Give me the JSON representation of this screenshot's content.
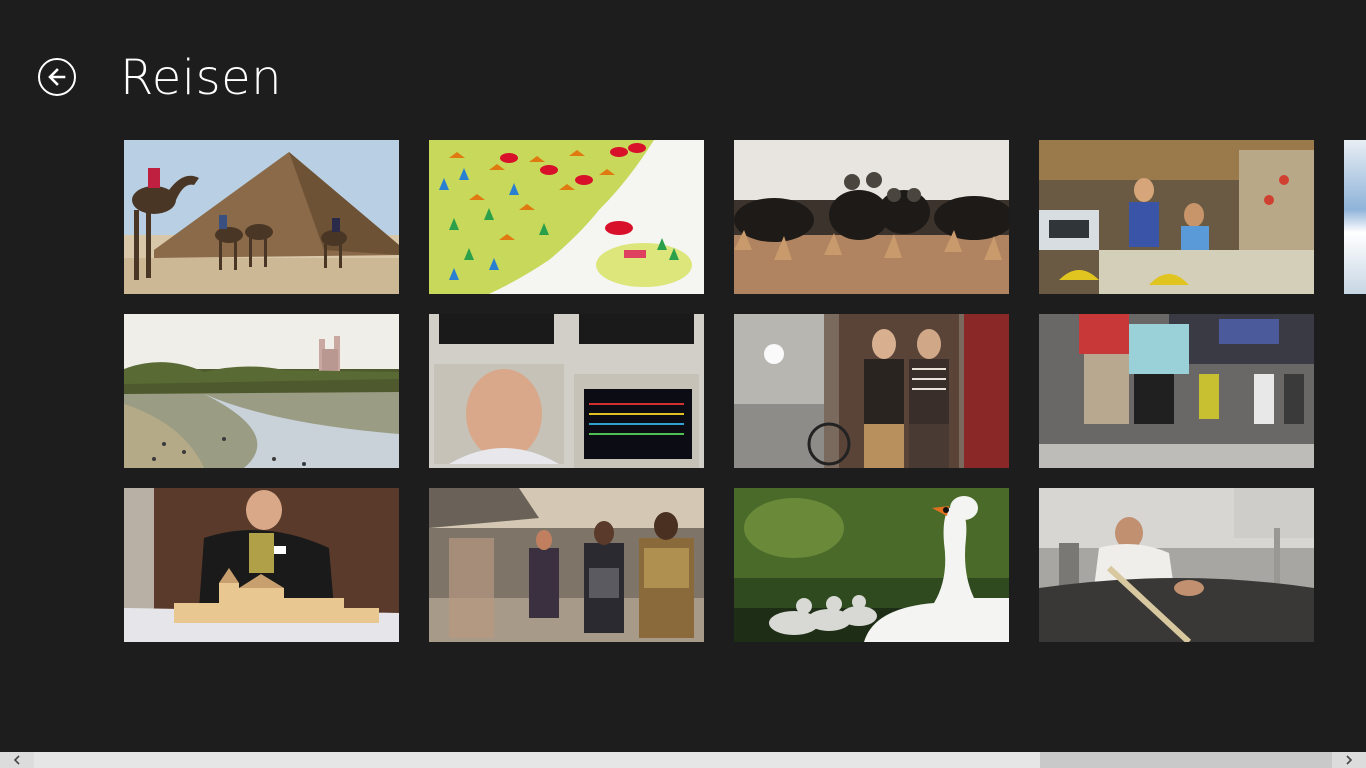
{
  "page": {
    "title": "Reisen"
  },
  "colors": {
    "background": "#1d1d1d",
    "text": "#ffffff",
    "scrollbar_track": "#c9c9c9",
    "scrollbar_thumb": "#e6e6e6"
  },
  "icons": {
    "back": "back-arrow-icon",
    "scroll_left": "chevron-left-icon",
    "scroll_right": "chevron-right-icon"
  },
  "tiles": [
    {
      "subject": "camels-pyramid"
    },
    {
      "subject": "illustrated-map-umbrellas"
    },
    {
      "subject": "black-sheep"
    },
    {
      "subject": "market-vendor"
    },
    {
      "subject": "river-bank-city"
    },
    {
      "subject": "control-room-monitors"
    },
    {
      "subject": "two-men-street"
    },
    {
      "subject": "train-platform"
    },
    {
      "subject": "man-building-model"
    },
    {
      "subject": "pedestrian-street"
    },
    {
      "subject": "swan-cygnets"
    },
    {
      "subject": "brewer-kettle"
    }
  ]
}
